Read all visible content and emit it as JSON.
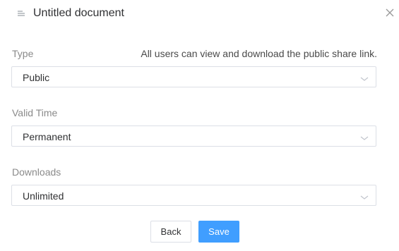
{
  "dialog": {
    "title": "Untitled document",
    "icon": "document-icon",
    "close_icon": "close-icon"
  },
  "type": {
    "label": "Type",
    "hint": "All users can view and download the public share link.",
    "value": "Public"
  },
  "valid_time": {
    "label": "Valid Time",
    "value": "Permanent"
  },
  "downloads": {
    "label": "Downloads",
    "value": "Unlimited"
  },
  "actions": {
    "back_label": "Back",
    "save_label": "Save"
  },
  "colors": {
    "primary": "#409eff",
    "border": "#dcdfe6"
  }
}
